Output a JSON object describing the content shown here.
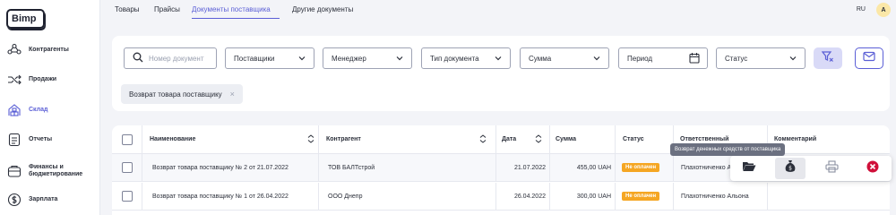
{
  "app": {
    "logo": "Bimp"
  },
  "sidebar": {
    "items": [
      {
        "label": "Контрагенты",
        "icon": "contractors-icon"
      },
      {
        "label": "Продажи",
        "icon": "sales-icon"
      },
      {
        "label": "Склад",
        "icon": "warehouse-icon"
      },
      {
        "label": "Отчеты",
        "icon": "reports-icon"
      },
      {
        "label": "Финансы и бюджетирование",
        "icon": "finance-icon"
      },
      {
        "label": "Зарплата",
        "icon": "salary-icon"
      }
    ],
    "active_index": 2
  },
  "tabs": [
    "Товары",
    "Прайсы",
    "Документы поставщика",
    "Другие документы"
  ],
  "active_tab": "Документы поставщика",
  "header": {
    "lang": "RU",
    "avatar": "A"
  },
  "filters": {
    "search_placeholder": "Номер документ",
    "supplier": "Поставщики",
    "manager": "Менеджер",
    "doc_type": "Тип документа",
    "sum": "Сумма",
    "period": "Период",
    "status": "Статус"
  },
  "active_filter_chip": "Возврат товара поставщику",
  "table": {
    "headers": {
      "name": "Наименование",
      "contractor": "Контрагент",
      "date": "Дата",
      "sum": "Сумма",
      "status": "Статус",
      "responsible": "Ответственный",
      "comment": "Комментарий"
    },
    "rows": [
      {
        "name": "Возврат товара поставщику № 2 от 21.07.2022",
        "contractor": "ТОВ БАЛТстрой",
        "date": "21.07.2022",
        "sum": "455,00 UAH",
        "status": "Не оплачен",
        "responsible": "Плахотниченко А"
      },
      {
        "name": "Возврат товара поставщику № 1 от 26.04.2022",
        "contractor": "ООО Днепр",
        "date": "26.04.2022",
        "sum": "300,00 UAH",
        "status": "Не оплачен",
        "responsible": "Плахотниченко Альона"
      }
    ]
  },
  "row_actions": {
    "tooltip": "Возврат денежных средств от поставщика",
    "icons": [
      "folder-icon",
      "money-bag-icon",
      "printer-icon",
      "delete-icon"
    ]
  },
  "colors": {
    "accent": "#5b5fd6",
    "badge": "#f5a623",
    "danger": "#d0103a"
  }
}
